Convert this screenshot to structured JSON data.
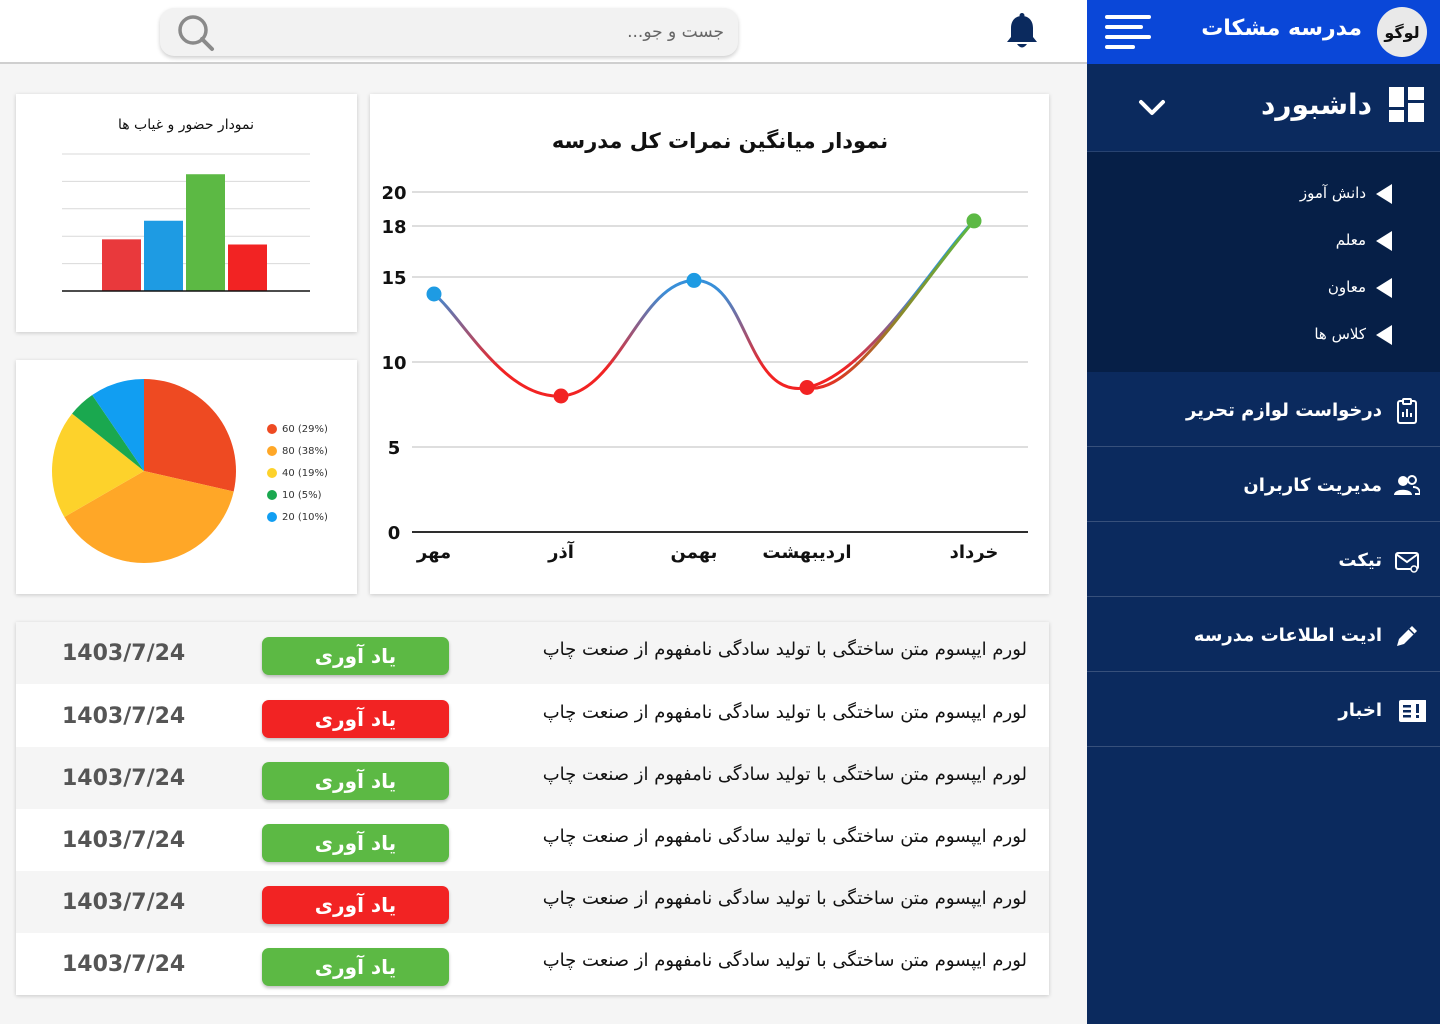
{
  "app": {
    "logo_text": "لوگو",
    "school_name": "مدرسه مشکات"
  },
  "search": {
    "placeholder": "جست و جو..."
  },
  "sidebar": {
    "dashboard_label": "داشبورد",
    "submenu": [
      {
        "label": "دانش آموز"
      },
      {
        "label": "معلم"
      },
      {
        "label": "معاون"
      },
      {
        "label": "کلاس ها"
      }
    ],
    "items": [
      {
        "label": "درخواست لوازم تحریر",
        "icon": "clipboard-icon"
      },
      {
        "label": "مدیریت کاربران",
        "icon": "users-icon"
      },
      {
        "label": "تیکت",
        "icon": "envelope-icon"
      },
      {
        "label": "ادیت اطلاعات مدرسه",
        "icon": "pencil-icon"
      },
      {
        "label": "اخبار",
        "icon": "news-icon"
      }
    ]
  },
  "colors": {
    "sidebar_bg": "#0b2a5e",
    "header_blue": "#0a47d8",
    "green": "#5cb944",
    "red": "#f22323"
  },
  "chart_data": [
    {
      "type": "bar",
      "title": "نمودار حضور و غیاب ها",
      "values": [
        50,
        68,
        113,
        45
      ],
      "colors": [
        "#e9393c",
        "#1e9be3",
        "#5cb944",
        "#f22323"
      ],
      "grid": true
    },
    {
      "type": "pie",
      "slices": [
        {
          "label": "60 (29%)",
          "value": 60,
          "percent": 29,
          "color": "#ee4a22"
        },
        {
          "label": "80 (38%)",
          "value": 80,
          "percent": 38,
          "color": "#ffa727"
        },
        {
          "label": "40 (19%)",
          "value": 40,
          "percent": 19,
          "color": "#fdd22b"
        },
        {
          "label": "10 (5%)",
          "value": 10,
          "percent": 5,
          "color": "#1aa84f"
        },
        {
          "label": "20 (10%)",
          "value": 20,
          "percent": 10,
          "color": "#119ef2"
        }
      ],
      "legend": "right"
    },
    {
      "type": "line",
      "title": "نمودار میانگین نمرات کل مدرسه",
      "categories": [
        "مهر",
        "آذر",
        "بهمن",
        "اردیبهشت",
        "خرداد"
      ],
      "values": [
        14,
        8,
        14.8,
        8.5,
        18.3
      ],
      "y_ticks": [
        "0",
        "5",
        "10",
        "15",
        "18",
        "20"
      ],
      "ylim": [
        0,
        20
      ],
      "point_colors": [
        "#1e9be3",
        "#f22323",
        "#1e9be3",
        "#f22323",
        "#5cb944"
      ],
      "grid": true
    }
  ],
  "table": {
    "rows": [
      {
        "text": "لورم ایپسوم متن ساختگی با تولید سادگی نامفهوم از صنعت چاپ",
        "button": "یاد آوری",
        "status": "green",
        "date": "1403/7/24"
      },
      {
        "text": "لورم ایپسوم متن ساختگی با تولید سادگی نامفهوم از صنعت چاپ",
        "button": "یاد آوری",
        "status": "red",
        "date": "1403/7/24"
      },
      {
        "text": "لورم ایپسوم متن ساختگی با تولید سادگی نامفهوم از صنعت چاپ",
        "button": "یاد آوری",
        "status": "green",
        "date": "1403/7/24"
      },
      {
        "text": "لورم ایپسوم متن ساختگی با تولید سادگی نامفهوم از صنعت چاپ",
        "button": "یاد آوری",
        "status": "green",
        "date": "1403/7/24"
      },
      {
        "text": "لورم ایپسوم متن ساختگی با تولید سادگی نامفهوم از صنعت چاپ",
        "button": "یاد آوری",
        "status": "red",
        "date": "1403/7/24"
      },
      {
        "text": "لورم ایپسوم متن ساختگی با تولید سادگی نامفهوم از صنعت چاپ",
        "button": "یاد آوری",
        "status": "green",
        "date": "1403/7/24"
      }
    ]
  }
}
